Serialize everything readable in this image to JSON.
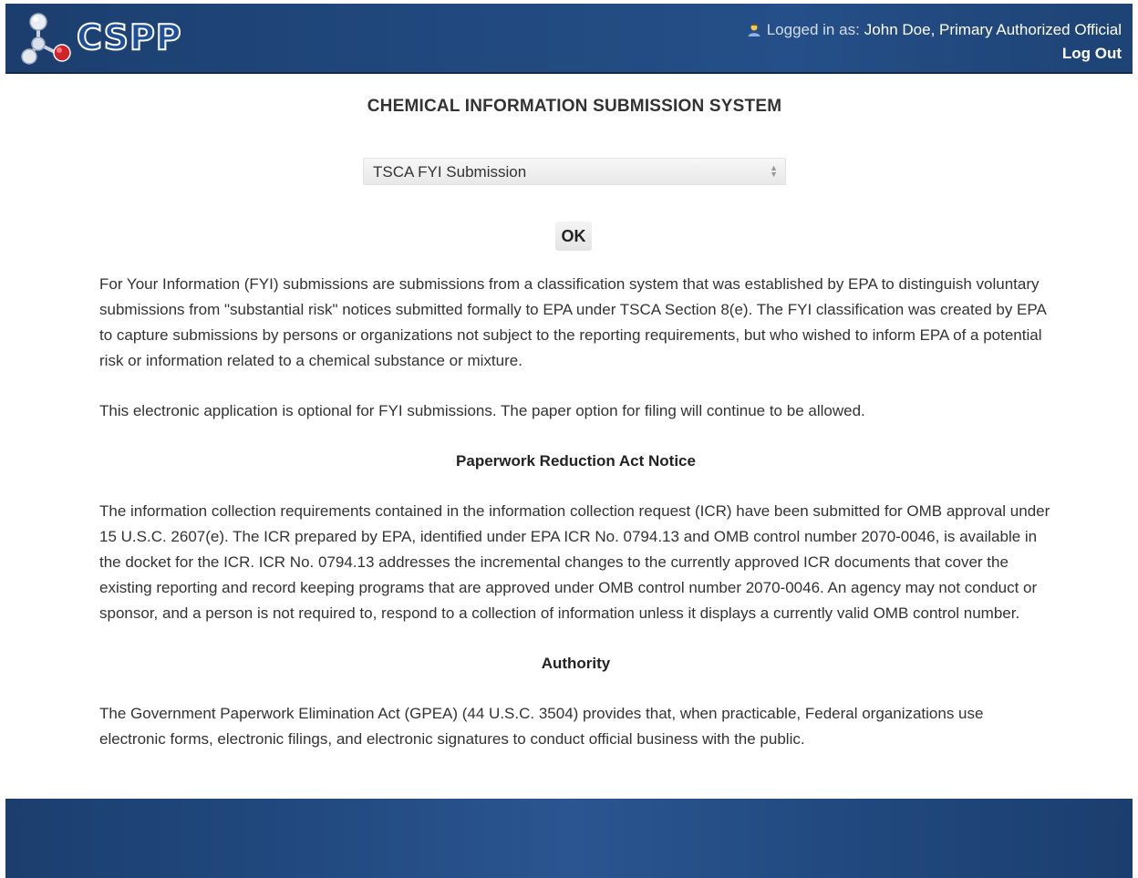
{
  "header": {
    "logo_text": "CSPP",
    "logged_in_prefix": "Logged in as:",
    "user_name": "John Doe, Primary Authorized Official",
    "logout_label": "Log Out"
  },
  "main": {
    "title": "CHEMICAL INFORMATION SUBMISSION SYSTEM",
    "submission_select": {
      "selected_value": "TSCA FYI Submission"
    },
    "ok_label": "OK",
    "paragraphs": {
      "intro": "For Your Information (FYI) submissions are submissions from a classification system that was established by EPA to distinguish voluntary submissions from \"substantial risk\" notices submitted formally to EPA under TSCA Section 8(e). The FYI classification was created by EPA to capture submissions by persons or organizations not subject to the reporting requirements, but who wished to inform EPA of a potential risk or information related to a chemical substance or mixture.",
      "optional": "This electronic application is optional for FYI submissions. The paper option for filing will continue to be allowed.",
      "pra_heading": "Paperwork Reduction Act Notice",
      "pra_text": "The information collection requirements contained in the information collection request (ICR) have been submitted for OMB approval under 15 U.S.C. 2607(e). The ICR prepared by EPA, identified under EPA ICR No. 0794.13 and OMB control number 2070-0046, is available in the docket for the ICR. ICR No. 0794.13 addresses the incremental changes to the currently approved ICR documents that cover the existing reporting and record keeping programs that are approved under OMB control number 2070-0046. An agency may not conduct or sponsor, and a person is not required to, respond to a collection of information unless it displays a currently valid OMB control number.",
      "authority_heading": "Authority",
      "authority_text": "The Government Paperwork Elimination Act (GPEA) (44 U.S.C. 3504) provides that, when practicable, Federal organizations use electronic forms, electronic filings, and electronic signatures to conduct official business with the public."
    }
  },
  "icons": {
    "logo": "molecule-logo-icon",
    "user": "user-icon",
    "select_arrow": "select-arrows-icon"
  },
  "colors": {
    "header_bg": "#21497f",
    "footer_bg": "#21497f",
    "text": "#333333"
  }
}
